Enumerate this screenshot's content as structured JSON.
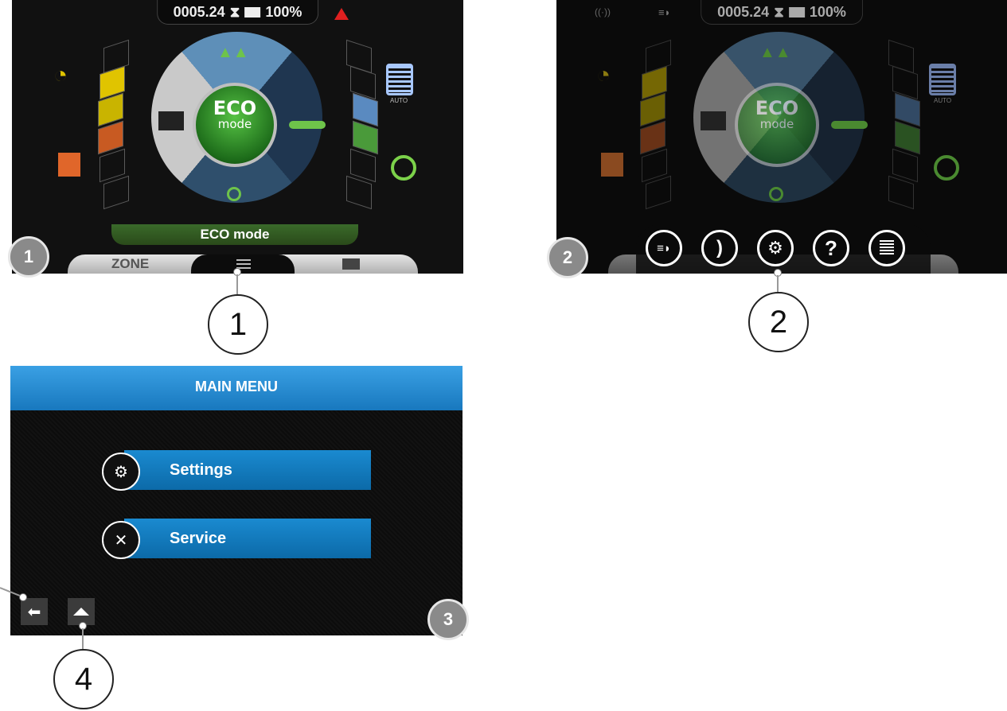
{
  "panel1": {
    "odometer": "0005.24",
    "battery": "100%",
    "eco_line1": "ECO",
    "eco_line2": "mode",
    "mode_bar": "ECO mode",
    "tab_zone": "ZONE",
    "badge": "1"
  },
  "panel2": {
    "odometer": "0005.24",
    "battery": "100%",
    "eco_line1": "ECO",
    "eco_line2": "mode",
    "auto_label": "AUTO",
    "help_glyph": "?",
    "badge": "2"
  },
  "panel1_auto": "AUTO",
  "panel3": {
    "title": "MAIN MENU",
    "items": [
      {
        "label": "Settings",
        "icon": "gears-icon"
      },
      {
        "label": "Service",
        "icon": "wrench-screwdriver-icon"
      }
    ],
    "badge": "3"
  },
  "callouts": [
    "1",
    "2",
    "4"
  ],
  "colors": {
    "eco_green": "#3aa832",
    "menu_blue": "#1a8ad0",
    "title_blue": "#2a8fd4",
    "yellow": "#e0c400",
    "orange": "#e0662a",
    "badge_gray": "#8a8a8a"
  }
}
